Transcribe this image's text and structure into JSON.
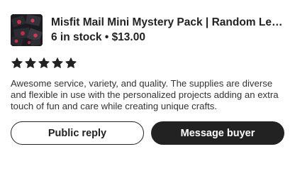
{
  "listing": {
    "title": "Misfit Mail Mini Mystery Pack | Random Leftov…",
    "stock": "6 in stock",
    "separator": "•",
    "price": "$13.00",
    "thumbnail_icon": "product-thumbnail"
  },
  "rating": {
    "stars": 5,
    "max": 5,
    "star_color": "#222222"
  },
  "review": {
    "text": "Awesome service, variety, and quality. The supplies are diverse and flexible in use with the personalized projects adding an extra touch of fun and care while creating unique crafts."
  },
  "actions": {
    "public_reply_label": "Public reply",
    "message_buyer_label": "Message buyer"
  }
}
